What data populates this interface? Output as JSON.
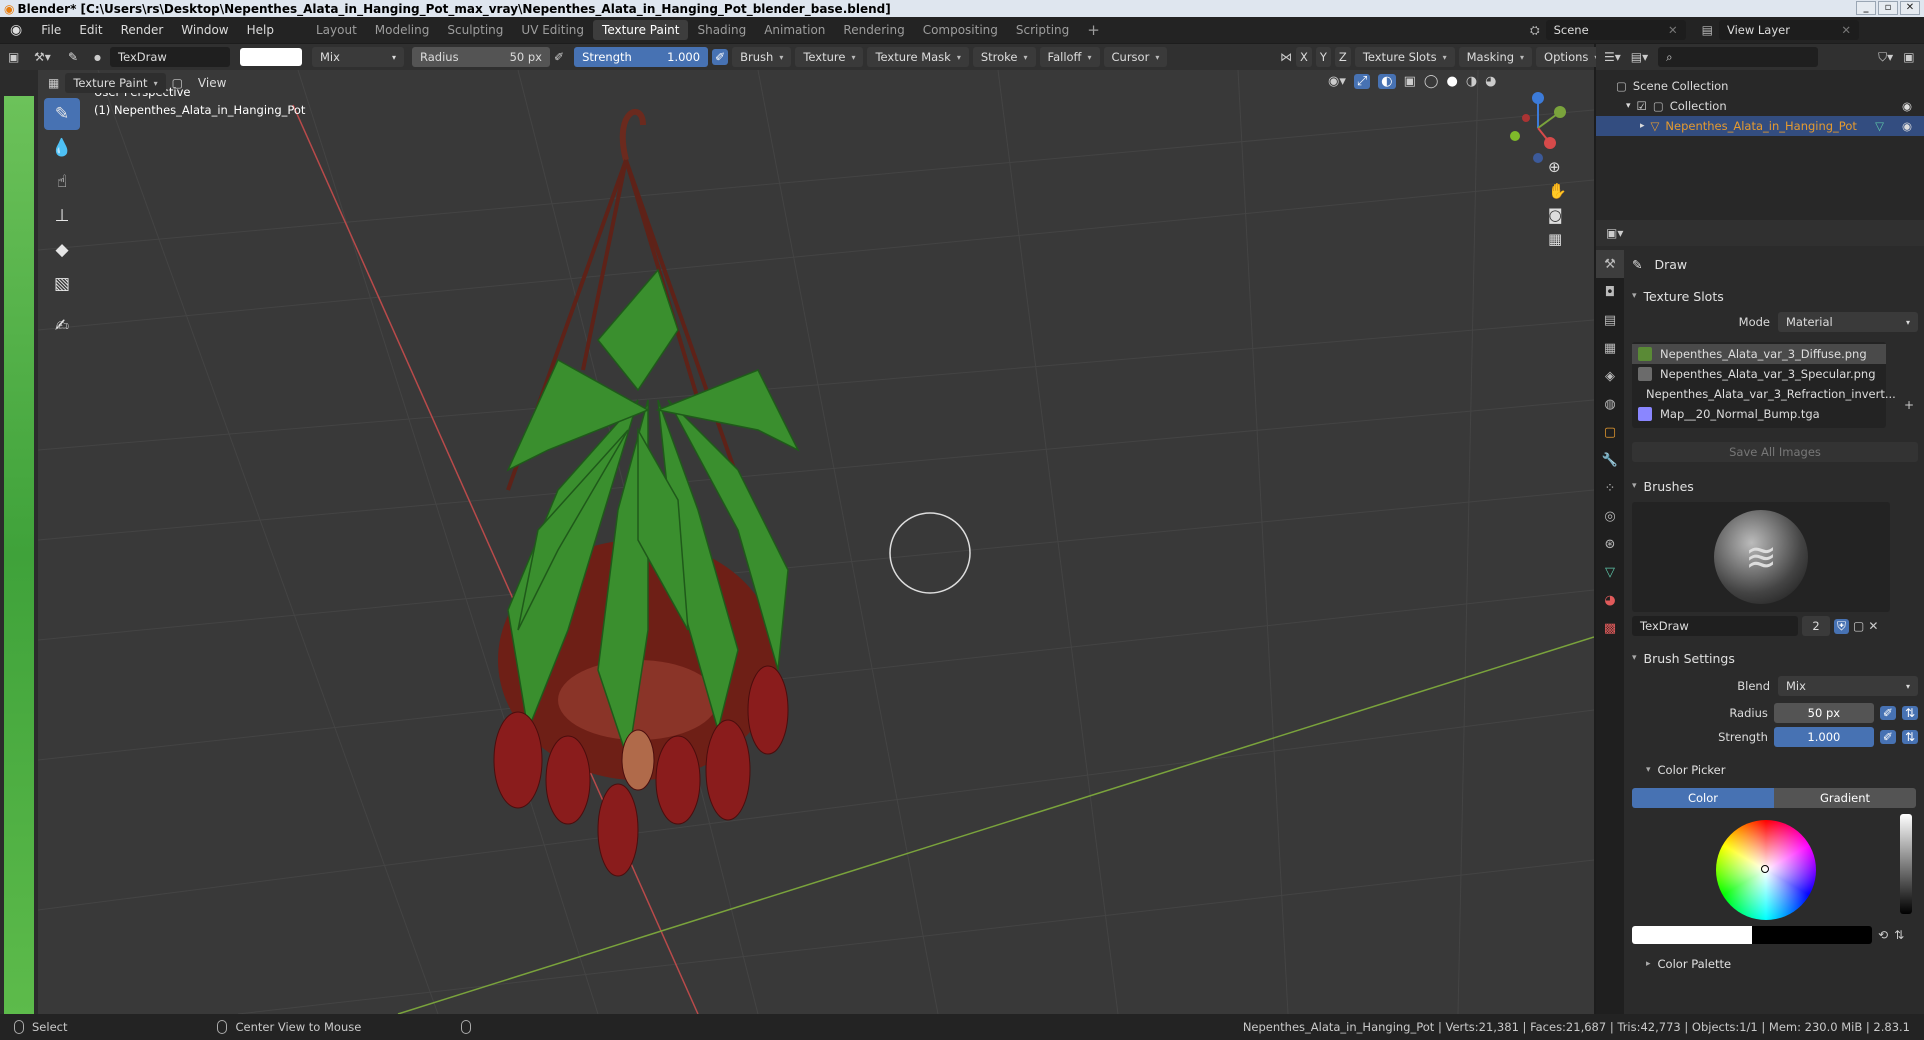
{
  "window": {
    "title": "Blender* [C:\\Users\\rs\\Desktop\\Nepenthes_Alata_in_Hanging_Pot_max_vray\\Nepenthes_Alata_in_Hanging_Pot_blender_base.blend]",
    "controls": [
      "_",
      "▫",
      "✕"
    ]
  },
  "menu": {
    "items": [
      "File",
      "Edit",
      "Render",
      "Window",
      "Help"
    ],
    "workspaces": [
      "Layout",
      "Modeling",
      "Sculpting",
      "UV Editing",
      "Texture Paint",
      "Shading",
      "Animation",
      "Rendering",
      "Compositing",
      "Scripting"
    ],
    "active_workspace": "Texture Paint",
    "add_tab": "+",
    "scene_label": "Scene",
    "view_layer_label": "View Layer"
  },
  "toolheader": {
    "brush_name": "TexDraw",
    "blend_mode": "Mix",
    "radius_label": "Radius",
    "radius_value": "50 px",
    "strength_label": "Strength",
    "strength_value": "1.000",
    "strength_fraction": 1.0,
    "dropdowns": [
      "Brush",
      "Texture",
      "Texture Mask",
      "Stroke",
      "Falloff",
      "Cursor"
    ],
    "axes": [
      "X",
      "Y",
      "Z"
    ],
    "right_dropdowns": [
      "Texture Slots",
      "Masking",
      "Options"
    ]
  },
  "viewheader": {
    "mode": "Texture Paint",
    "view": "View"
  },
  "viewport": {
    "perspective_label": "User Perspective",
    "object_label": "(1) Nepenthes_Alata_in_Hanging_Pot",
    "gizmo_axes": [
      "X",
      "Y",
      "Z"
    ],
    "colors": {
      "x_axis": "#b84a4a",
      "y_axis": "#7aa33c",
      "background": "#393939"
    }
  },
  "outliner": {
    "scene_collection": "Scene Collection",
    "collection": "Collection",
    "object": "Nepenthes_Alata_in_Hanging_Pot",
    "object_color": "#e59a2f"
  },
  "properties": {
    "tool_name": "Draw",
    "texture_slots": {
      "title": "Texture Slots",
      "mode_label": "Mode",
      "mode_value": "Material",
      "slots": [
        {
          "name": "Nepenthes_Alata_var_3_Diffuse.png",
          "color": "#5a8a36"
        },
        {
          "name": "Nepenthes_Alata_var_3_Specular.png",
          "color": "#6b6b6b"
        },
        {
          "name": "Nepenthes_Alata_var_3_Refraction_invert...",
          "color": "#e8e8e8"
        },
        {
          "name": "Map__20_Normal_Bump.tga",
          "color": "#8a86ff"
        }
      ],
      "save_all": "Save All Images"
    },
    "brushes": {
      "title": "Brushes",
      "brush_name": "TexDraw",
      "users": "2"
    },
    "brush_settings": {
      "title": "Brush Settings",
      "blend_label": "Blend",
      "blend_value": "Mix",
      "radius_label": "Radius",
      "radius_value": "50 px",
      "strength_label": "Strength",
      "strength_value": "1.000"
    },
    "color_picker": {
      "title": "Color Picker",
      "tab_color": "Color",
      "tab_gradient": "Gradient",
      "primary_color": "#ffffff",
      "secondary_color": "#000000"
    },
    "color_palette": {
      "title": "Color Palette"
    }
  },
  "statusbar": {
    "select": "Select",
    "center_view": "Center View to Mouse",
    "stats": "Nepenthes_Alata_in_Hanging_Pot | Verts:21,381 | Faces:21,687 | Tris:42,773 | Objects:1/1 | Mem: 230.0 MiB | 2.83.1"
  }
}
